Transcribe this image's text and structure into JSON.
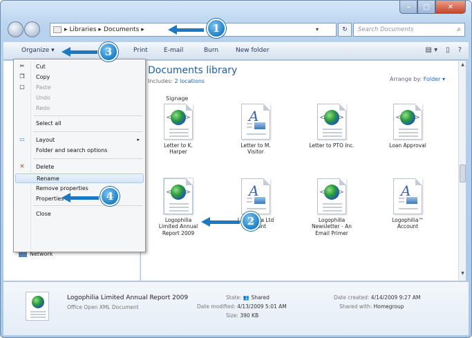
{
  "address": {
    "crumbs": [
      "Libraries",
      "Documents"
    ],
    "search_placeholder": "Search Documents"
  },
  "toolbar": {
    "organize": "Organize ▾",
    "items": [
      "Print",
      "E-mail",
      "Burn",
      "New folder"
    ]
  },
  "library": {
    "title": "Documents library",
    "includes_label": "Includes:",
    "includes_link": "2 locations",
    "arrange_label": "Arrange by:",
    "arrange_value": "Folder ▾",
    "group_label": "Signage"
  },
  "files": [
    {
      "name": "Letter to K.\nHarper",
      "kind": "globe"
    },
    {
      "name": "Letter to M.\nVisitor",
      "kind": "image"
    },
    {
      "name": "Letter to PTO Inc.",
      "kind": "globe"
    },
    {
      "name": "Loan Approval",
      "kind": "globe"
    },
    {
      "name": "Logophilia\nLimited Annual\nReport 2009",
      "kind": "globe"
    },
    {
      "name": "Logophilia Ltd\nAccount",
      "kind": "image"
    },
    {
      "name": "Logophilia\nNewsletter - An\nEmail Primer",
      "kind": "globe"
    },
    {
      "name": "Logophilia™\nAccount",
      "kind": "image"
    }
  ],
  "menu": {
    "items": [
      {
        "label": "Cut",
        "icon": "cut-icon",
        "glyph": "✂",
        "disabled": false
      },
      {
        "label": "Copy",
        "icon": "copy-icon",
        "glyph": "❐",
        "disabled": false
      },
      {
        "label": "Paste",
        "icon": "paste-icon",
        "glyph": "▢",
        "disabled": true
      },
      {
        "label": "Undo",
        "icon": "",
        "glyph": "",
        "disabled": true
      },
      {
        "label": "Redo",
        "icon": "",
        "glyph": "",
        "disabled": true
      },
      {
        "label": "Select all",
        "icon": "",
        "glyph": "",
        "disabled": false
      },
      {
        "label": "Layout",
        "icon": "layout-icon",
        "glyph": "▭",
        "disabled": false,
        "submenu": "▸"
      },
      {
        "label": "Folder and search options",
        "icon": "",
        "glyph": "",
        "disabled": false
      },
      {
        "label": "Delete",
        "icon": "delete-icon",
        "glyph": "✕",
        "disabled": false
      },
      {
        "label": "Rename",
        "icon": "",
        "glyph": "",
        "disabled": false
      },
      {
        "label": "Remove properties",
        "icon": "",
        "glyph": "",
        "disabled": false
      },
      {
        "label": "Properties",
        "icon": "",
        "glyph": "",
        "disabled": false
      },
      {
        "label": "Close",
        "icon": "",
        "glyph": "",
        "disabled": false
      }
    ]
  },
  "nav": {
    "network": "Network"
  },
  "details": {
    "title": "Logophilia Limited Annual Report 2009",
    "type": "Office Open XML Document",
    "state_label": "State:",
    "state_value": "Shared",
    "modified_label": "Date modified:",
    "modified_value": "4/13/2009 5:01 AM",
    "size_label": "Size:",
    "size_value": "390 KB",
    "created_label": "Date created:",
    "created_value": "4/14/2009 9:27 AM",
    "shared_label": "Shared with:",
    "shared_value": "Homegroup"
  },
  "callouts": [
    "1",
    "2",
    "3",
    "4"
  ],
  "colors": {
    "accent": "#1d78c2",
    "library_title": "#1e5ea8",
    "link": "#1b64bf"
  }
}
